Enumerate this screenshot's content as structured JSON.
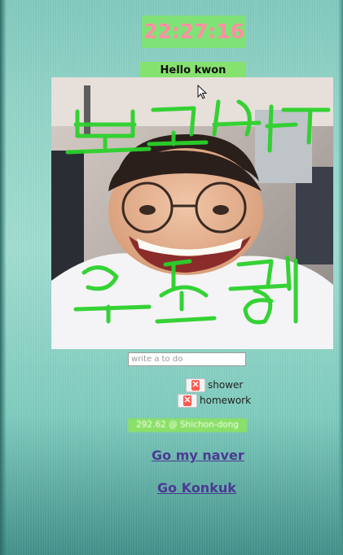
{
  "clock": {
    "time": "22:27:16"
  },
  "greeting": {
    "text": "Hello kwon"
  },
  "photo": {
    "overlay_text_top": "보고싶다",
    "overlay_text_bottom": "유승엽",
    "overlay_color": "#2bd12b"
  },
  "todo": {
    "placeholder": "write a to do",
    "delete_symbol": "✕",
    "items": [
      {
        "label": "shower"
      },
      {
        "label": "homework"
      }
    ]
  },
  "weather": {
    "text": "292.62 @ Shichon-dong"
  },
  "links": {
    "naver": "Go my naver",
    "konkuk": "Go Konkuk"
  },
  "colors": {
    "background": "#8fd3c6",
    "clock_bg": "#7ee277",
    "clock_text": "#ff8fa3",
    "greeting_bg": "#86e26f",
    "link": "#4b3a93",
    "delete_icon": "#ff5b4f"
  }
}
